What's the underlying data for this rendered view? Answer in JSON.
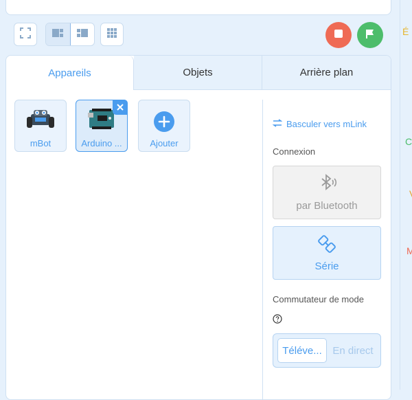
{
  "toolbar": {
    "fullscreen_icon": "fullscreen-icon",
    "layout_modes": [
      "layout-wide-icon",
      "layout-narrow-icon"
    ],
    "grid_icon": "grid-icon",
    "stop_icon": "stop-icon",
    "go_icon": "green-flag-icon",
    "stop_color": "#ef6b55",
    "go_color": "#4dbd6b"
  },
  "edge_letters": [
    {
      "text": "É",
      "color": "#e6b52c"
    },
    {
      "text": "C",
      "color": "#4dbd6b"
    },
    {
      "text": "V",
      "color": "#e6a12c"
    },
    {
      "text": "M",
      "color": "#ef6b55"
    }
  ],
  "tabs": [
    {
      "label": "Appareils",
      "active": true
    },
    {
      "label": "Objets",
      "active": false
    },
    {
      "label": "Arrière plan",
      "active": false
    }
  ],
  "devices": [
    {
      "label": "mBot",
      "icon": "mbot-robot-icon",
      "selected": false
    },
    {
      "label": "Arduino ...",
      "icon": "arduino-board-icon",
      "selected": true
    },
    {
      "label": "Ajouter",
      "icon": "add-icon",
      "selected": false
    }
  ],
  "panel": {
    "mlink_label": "Basculer vers mLink",
    "connection_label": "Connexion",
    "bluetooth_label": "par Bluetooth",
    "serial_label": "Série",
    "mode_switch_label": "Commutateur de mode",
    "mode_upload": "Téléve...",
    "mode_live": "En direct"
  },
  "accent_color": "#4a9cee"
}
